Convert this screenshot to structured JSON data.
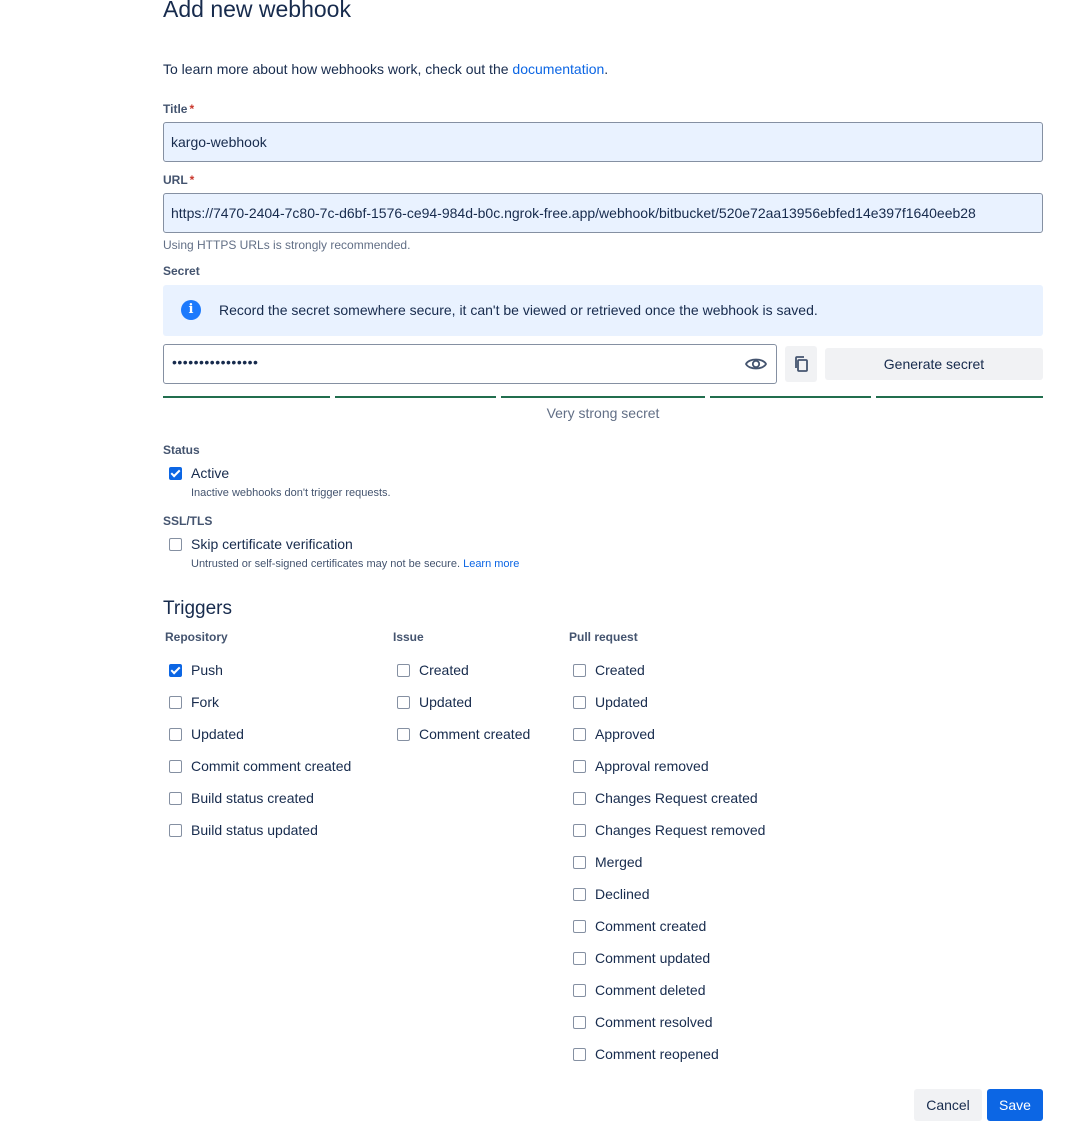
{
  "page": {
    "title": "Add new webhook",
    "intro_text": "To learn more about how webhooks work, check out the ",
    "intro_link": "documentation",
    "intro_end": "."
  },
  "title_field": {
    "label": "Title",
    "required_mark": "*",
    "value": "kargo-webhook"
  },
  "url_field": {
    "label": "URL",
    "required_mark": "*",
    "value": "https://7470-2404-7c80-7c-d6bf-1576-ce94-984d-b0c.ngrok-free.app/webhook/bitbucket/520e72aa13956ebfed14e397f1640eeb28",
    "helper": "Using HTTPS URLs is strongly recommended."
  },
  "secret": {
    "label": "Secret",
    "info": "Record the secret somewhere secure, it can't be viewed or retrieved once the webhook is saved.",
    "masked_value": "••••••••••••••••",
    "generate_label": "Generate secret",
    "strength_label": "Very strong secret",
    "strength_color": "#216e4e"
  },
  "status": {
    "label": "Status",
    "active_label": "Active",
    "active_checked": true,
    "active_helper": "Inactive webhooks don't trigger requests."
  },
  "ssl": {
    "label": "SSL/TLS",
    "skip_label": "Skip certificate verification",
    "skip_checked": false,
    "helper": "Untrusted or self-signed certificates may not be secure. ",
    "learn_more": "Learn more"
  },
  "triggers": {
    "heading": "Triggers",
    "repository": {
      "heading": "Repository",
      "items": [
        {
          "label": "Push",
          "checked": true
        },
        {
          "label": "Fork",
          "checked": false
        },
        {
          "label": "Updated",
          "checked": false
        },
        {
          "label": "Commit comment created",
          "checked": false
        },
        {
          "label": "Build status created",
          "checked": false
        },
        {
          "label": "Build status updated",
          "checked": false
        }
      ]
    },
    "issue": {
      "heading": "Issue",
      "items": [
        {
          "label": "Created",
          "checked": false
        },
        {
          "label": "Updated",
          "checked": false
        },
        {
          "label": "Comment created",
          "checked": false
        }
      ]
    },
    "pull_request": {
      "heading": "Pull request",
      "items": [
        {
          "label": "Created",
          "checked": false
        },
        {
          "label": "Updated",
          "checked": false
        },
        {
          "label": "Approved",
          "checked": false
        },
        {
          "label": "Approval removed",
          "checked": false
        },
        {
          "label": "Changes Request created",
          "checked": false
        },
        {
          "label": "Changes Request removed",
          "checked": false
        },
        {
          "label": "Merged",
          "checked": false
        },
        {
          "label": "Declined",
          "checked": false
        },
        {
          "label": "Comment created",
          "checked": false
        },
        {
          "label": "Comment updated",
          "checked": false
        },
        {
          "label": "Comment deleted",
          "checked": false
        },
        {
          "label": "Comment resolved",
          "checked": false
        },
        {
          "label": "Comment reopened",
          "checked": false
        }
      ]
    }
  },
  "actions": {
    "cancel_label": "Cancel",
    "save_label": "Save"
  },
  "colors": {
    "accent": "#0c66e4",
    "info_bg": "#e9f2ff",
    "text": "#172b4d"
  }
}
